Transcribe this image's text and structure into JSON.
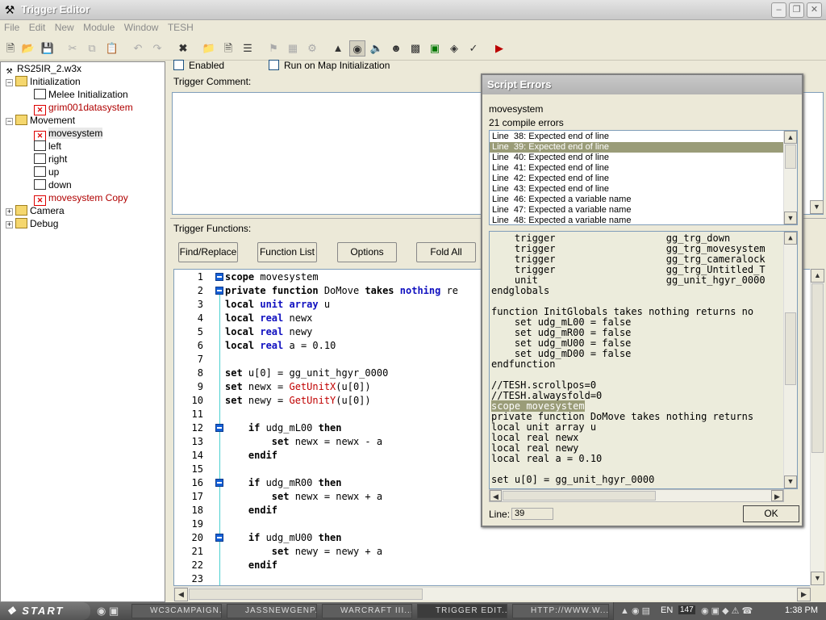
{
  "window": {
    "title": "Trigger Editor",
    "icon": "trigger-editor-icon"
  },
  "menu": [
    "File",
    "Edit",
    "New",
    "Module",
    "Window",
    "TESH"
  ],
  "toolbar": {
    "icons": [
      "new-icon",
      "open-icon",
      "save-icon",
      "cut-icon",
      "copy-icon",
      "paste-icon",
      "undo-icon",
      "redo-icon",
      "delete-icon",
      "new-category-icon",
      "new-trigger-icon",
      "new-comment-icon",
      "new-event-icon",
      "new-condition-icon",
      "new-action-icon",
      "terrain-editor-icon",
      "unit-editor-icon",
      "sound-editor-icon",
      "ai-editor-icon",
      "object-editor-icon",
      "campaign-editor-icon",
      "import-manager-icon",
      "object-manager-icon",
      "test-map-icon"
    ]
  },
  "tree": {
    "root": "RS25IR_2.w3x",
    "items": [
      {
        "label": "Initialization",
        "type": "folder",
        "expanded": true
      },
      {
        "label": "Melee Initialization",
        "type": "trigger"
      },
      {
        "label": "grim001datasystem",
        "type": "error"
      },
      {
        "label": "Movement",
        "type": "folder",
        "expanded": true
      },
      {
        "label": "movesystem",
        "type": "error",
        "selected": true
      },
      {
        "label": "left",
        "type": "trigger"
      },
      {
        "label": "right",
        "type": "trigger"
      },
      {
        "label": "up",
        "type": "trigger"
      },
      {
        "label": "down",
        "type": "trigger"
      },
      {
        "label": "movesystem Copy",
        "type": "error"
      },
      {
        "label": "Camera",
        "type": "folder",
        "expanded": false
      },
      {
        "label": "Debug",
        "type": "folder",
        "expanded": false
      }
    ]
  },
  "trigger": {
    "enabled_label": "Enabled",
    "enabled": false,
    "run_on_init_label": "Run on Map Initialization",
    "run_on_init": false,
    "comment_label": "Trigger Comment:",
    "functions_label": "Trigger Functions:"
  },
  "buttons": {
    "find_replace": "Find/Replace",
    "function_list": "Function List",
    "options": "Options",
    "fold_all": "Fold All"
  },
  "code_lines": [
    {
      "n": "1",
      "t": "scope movesystem",
      "fold": true
    },
    {
      "n": "2",
      "t": "private function DoMove takes nothing re",
      "fold": true
    },
    {
      "n": "3",
      "t": "local unit array u"
    },
    {
      "n": "4",
      "t": "local real newx"
    },
    {
      "n": "5",
      "t": "local real newy"
    },
    {
      "n": "6",
      "t": "local real a = 0.10"
    },
    {
      "n": "7",
      "t": ""
    },
    {
      "n": "8",
      "t": "set u[0] = gg_unit_hgyr_0000"
    },
    {
      "n": "9",
      "t": "set newx = GetUnitX(u[0])"
    },
    {
      "n": "10",
      "t": "set newy = GetUnitY(u[0])"
    },
    {
      "n": "11",
      "t": ""
    },
    {
      "n": "12",
      "t": "    if udg_mL00 then",
      "fold": true
    },
    {
      "n": "13",
      "t": "        set newx = newx - a"
    },
    {
      "n": "14",
      "t": "    endif"
    },
    {
      "n": "15",
      "t": ""
    },
    {
      "n": "16",
      "t": "    if udg_mR00 then",
      "fold": true
    },
    {
      "n": "17",
      "t": "        set newx = newx + a"
    },
    {
      "n": "18",
      "t": "    endif"
    },
    {
      "n": "19",
      "t": ""
    },
    {
      "n": "20",
      "t": "    if udg_mU00 then",
      "fold": true
    },
    {
      "n": "21",
      "t": "        set newy = newy + a"
    },
    {
      "n": "22",
      "t": "    endif"
    },
    {
      "n": "23",
      "t": ""
    }
  ],
  "dialog": {
    "title": "Script Errors",
    "trigger_name": "movesystem",
    "error_count": "21 compile errors",
    "errors": [
      "Line  38: Expected end of line",
      "Line  39: Expected end of line",
      "Line  40: Expected end of line",
      "Line  41: Expected end of line",
      "Line  42: Expected end of line",
      "Line  43: Expected end of line",
      "Line  46: Expected a variable name",
      "Line  47: Expected a variable name",
      "Line  48: Expected a variable name"
    ],
    "selected_error": 1,
    "source_lines": [
      "    trigger                   gg_trg_down",
      "    trigger                   gg_trg_movesystem",
      "    trigger                   gg_trg_cameralock",
      "    trigger                   gg_trg_Untitled_T",
      "    unit                      gg_unit_hgyr_0000",
      "endglobals",
      "",
      "function InitGlobals takes nothing returns no",
      "    set udg_mL00 = false",
      "    set udg_mR00 = false",
      "    set udg_mU00 = false",
      "    set udg_mD00 = false",
      "endfunction",
      "",
      "//TESH.scrollpos=0",
      "//TESH.alwaysfold=0",
      "scope movesystem",
      "private function DoMove takes nothing returns",
      "local unit array u",
      "local real newx",
      "local real newy",
      "local real a = 0.10",
      "",
      "set u[0] = gg_unit_hgyr_0000"
    ],
    "highlight_line": 16,
    "line_label": "Line:",
    "line_value": "39",
    "ok_label": "OK"
  },
  "taskbar": {
    "start_label": "START",
    "tasks": [
      {
        "label": "WC3CAMPAIGN...",
        "icon": "firefox-icon"
      },
      {
        "label": "JASSNEWGENP...",
        "icon": "folder-icon"
      },
      {
        "label": "WARCRAFT III...",
        "icon": "warcraft-icon"
      },
      {
        "label": "TRIGGER EDIT...",
        "icon": "trigger-editor-icon",
        "active": true
      },
      {
        "label": "HTTP://WWW.W...",
        "icon": "firefox-icon"
      }
    ],
    "tray_lang": "EN",
    "tray_num": "147",
    "clock": "1:38 PM"
  }
}
